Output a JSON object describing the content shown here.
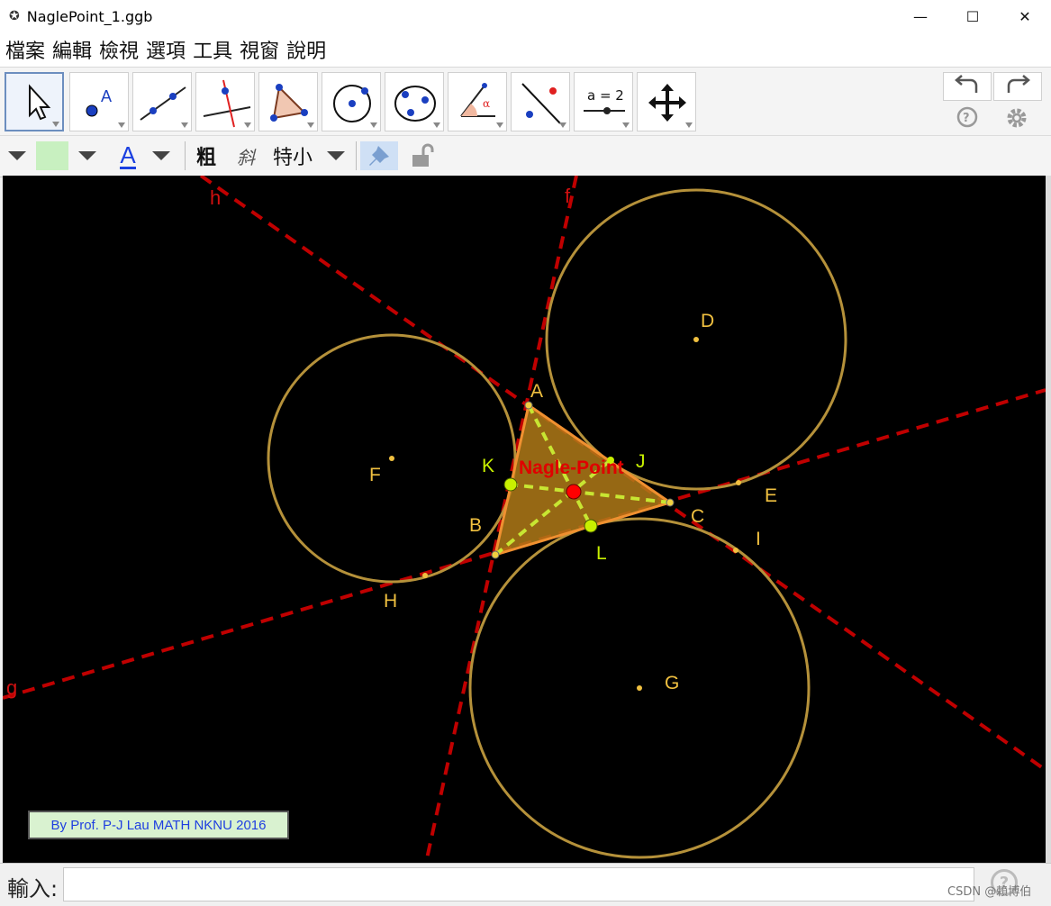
{
  "window": {
    "title": "NaglePoint_1.ggb",
    "minimize": "—",
    "maximize": "☐",
    "close": "✕"
  },
  "menu": [
    "檔案",
    "編輯",
    "檢視",
    "選項",
    "工具",
    "視窗",
    "說明"
  ],
  "toolbar": {
    "tools": [
      "move-tool",
      "point-tool",
      "line-tool",
      "perpendicular-tool",
      "polygon-tool",
      "circle-center-tool",
      "circle-three-points-tool",
      "angle-tool",
      "reflect-tool",
      "slider-tool",
      "move-view-tool"
    ],
    "slider_text": "a = 2"
  },
  "stylebar": {
    "bold": "粗",
    "italic": "斜",
    "size": "特小",
    "color_swatch": "#c8f0c0",
    "text_color_label": "A"
  },
  "canvas": {
    "lines": [
      {
        "label": "h",
        "color": "#c00000"
      },
      {
        "label": "f",
        "color": "#c00000"
      },
      {
        "label": "g",
        "color": "#c00000"
      }
    ],
    "circles": [
      "D",
      "F",
      "G"
    ],
    "points": {
      "A": "A",
      "B": "B",
      "C": "C",
      "D": "D",
      "E": "E",
      "F": "F",
      "G": "G",
      "H": "H",
      "I": "I",
      "J": "J",
      "K": "K",
      "L": "L"
    },
    "nagle_label": "Nagle-Point",
    "colors": {
      "circle": "#b5913a",
      "triangle_fill": "#b07a18",
      "triangle_edge": "#f09030",
      "cevian": "#c8e632",
      "nagle": "#ff0000",
      "point_label": "#f0c040",
      "tangent_label": "#c8f000"
    }
  },
  "credit": "By Prof. P-J Lau MATH NKNU 2016",
  "input": {
    "label": "輸入:",
    "value": ""
  },
  "watermark": "CSDN @賴博伯"
}
